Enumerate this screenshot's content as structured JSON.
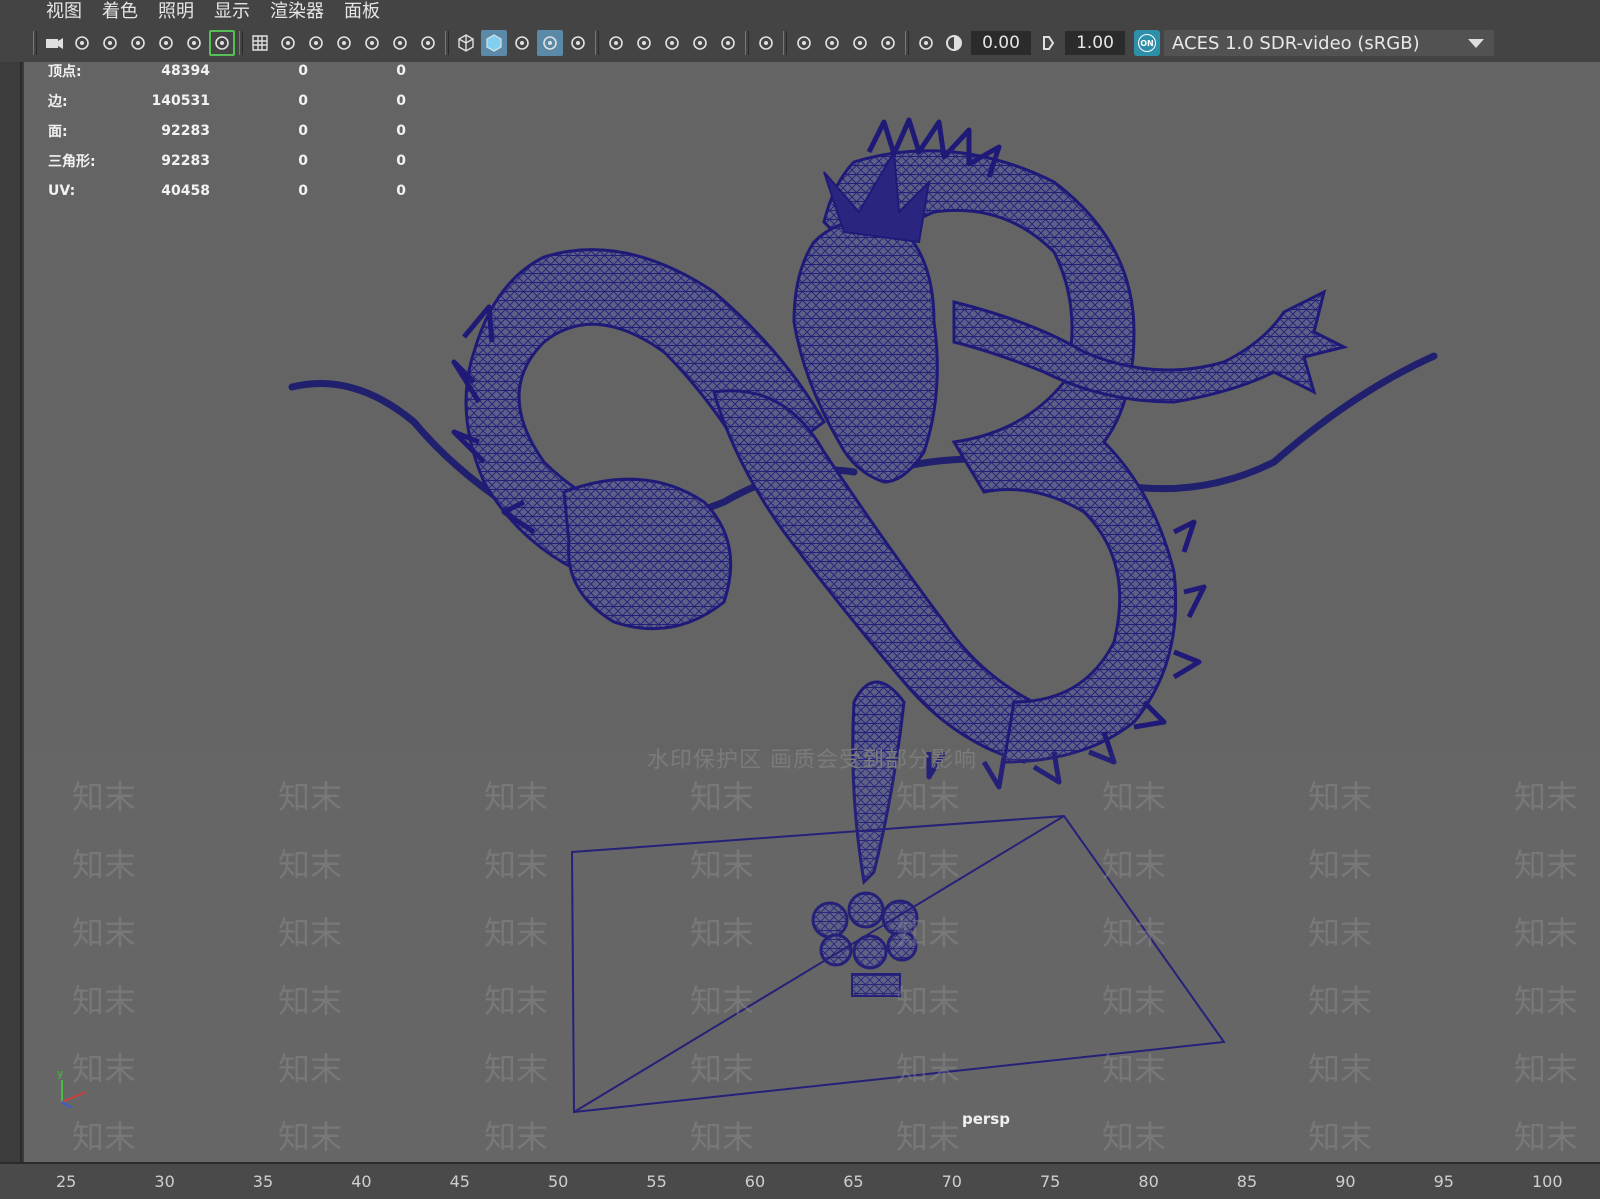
{
  "menu": [
    "视图",
    "着色",
    "照明",
    "显示",
    "渲染器",
    "面板"
  ],
  "toolbar": {
    "exposure_value": "0.00",
    "gamma_value": "1.00",
    "color_space_toggle": "ON",
    "color_space": "ACES 1.0 SDR-video (sRGB)",
    "icons": [
      "camera-icon",
      "camera-attributes-icon",
      "camera-lock-icon",
      "bookmark-icon",
      "image-plane-icon",
      "2d-pan-zoom-icon",
      "grease-pencil-icon",
      "grid-icon",
      "film-gate-icon",
      "resolution-gate-icon",
      "gate-mask-icon",
      "field-chart-icon",
      "safe-action-icon",
      "safe-title-icon",
      "wireframe-icon",
      "smooth-shade-icon",
      "use-default-material-icon",
      "wireframe-on-shaded-icon",
      "textured-icon",
      "use-all-lights-icon",
      "shadows-icon",
      "screen-space-ao-icon",
      "motion-blur-icon",
      "multisample-aa-icon",
      "depth-of-field-icon",
      "isolate-select-icon",
      "xray-icon",
      "xray-active-icon",
      "xray-joints-icon",
      "exposure-icon",
      "gamma-icon",
      "color-management-icon"
    ]
  },
  "hud": {
    "rows": [
      {
        "label": "顶点:",
        "value": "48394",
        "col2": "0",
        "col3": "0"
      },
      {
        "label": "边:",
        "value": "140531",
        "col2": "0",
        "col3": "0"
      },
      {
        "label": "面:",
        "value": "92283",
        "col2": "0",
        "col3": "0"
      },
      {
        "label": "三角形:",
        "value": "92283",
        "col2": "0",
        "col3": "0"
      },
      {
        "label": "UV:",
        "value": "40458",
        "col2": "0",
        "col3": "0"
      }
    ]
  },
  "viewport": {
    "camera_label": "persp",
    "wireframe_color": "#1f1a78",
    "background_color": "#646464",
    "axis_y_label": "y"
  },
  "watermark": {
    "title": "水印保护区  画质会受到部分影响",
    "mark": "知末"
  },
  "timeline": {
    "ticks": [
      "25",
      "30",
      "35",
      "40",
      "45",
      "50",
      "55",
      "60",
      "65",
      "70",
      "75",
      "80",
      "85",
      "90",
      "95",
      "100"
    ]
  }
}
